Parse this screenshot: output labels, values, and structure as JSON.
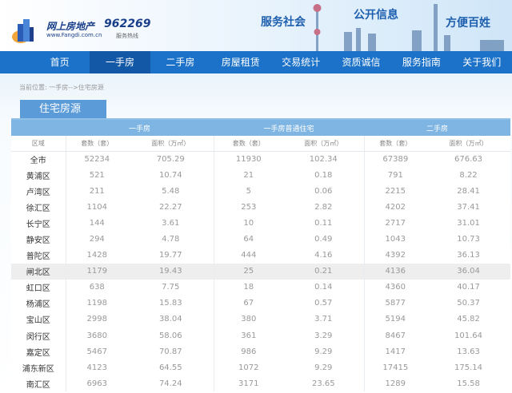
{
  "header": {
    "logo_text": "网上房地产",
    "logo_url": "www.Fangdi.com.cn",
    "phone": "962269",
    "phone_sub": "服务热线",
    "slogans": [
      "服务社会",
      "公开信息",
      "方便百姓"
    ]
  },
  "nav": [
    "首页",
    "一手房",
    "二手房",
    "房屋租赁",
    "交易统计",
    "资质诚信",
    "服务指南",
    "关于我们"
  ],
  "breadcrumb": "当前位置: 一手房-->住宅房源",
  "tab": "住宅房源",
  "table": {
    "groups": [
      "一手房",
      "一手房普通住宅",
      "二手房"
    ],
    "subheaders": [
      "区域",
      "套数（套）",
      "面积（万㎡）",
      "套数（套）",
      "面积（万㎡）",
      "套数（套）",
      "面积（万㎡）"
    ],
    "rows": [
      [
        "全市",
        "52234",
        "705.29",
        "11930",
        "102.34",
        "67389",
        "676.63"
      ],
      [
        "黄浦区",
        "521",
        "10.74",
        "21",
        "0.18",
        "791",
        "8.22"
      ],
      [
        "卢湾区",
        "211",
        "5.48",
        "5",
        "0.06",
        "2215",
        "28.41"
      ],
      [
        "徐汇区",
        "1104",
        "22.27",
        "253",
        "2.82",
        "4202",
        "37.41"
      ],
      [
        "长宁区",
        "144",
        "3.61",
        "10",
        "0.11",
        "2717",
        "31.01"
      ],
      [
        "静安区",
        "294",
        "4.78",
        "64",
        "0.49",
        "1043",
        "10.73"
      ],
      [
        "普陀区",
        "1428",
        "19.77",
        "444",
        "4.16",
        "4392",
        "36.13"
      ],
      [
        "闸北区",
        "1179",
        "19.43",
        "25",
        "0.21",
        "4136",
        "36.04"
      ],
      [
        "虹口区",
        "638",
        "7.75",
        "18",
        "0.14",
        "4360",
        "40.17"
      ],
      [
        "杨浦区",
        "1198",
        "15.83",
        "67",
        "0.57",
        "5877",
        "50.37"
      ],
      [
        "宝山区",
        "2998",
        "38.04",
        "380",
        "3.71",
        "5194",
        "45.82"
      ],
      [
        "闵行区",
        "3680",
        "58.06",
        "361",
        "3.29",
        "8467",
        "101.64"
      ],
      [
        "嘉定区",
        "5467",
        "70.87",
        "986",
        "9.29",
        "1417",
        "13.63"
      ],
      [
        "浦东新区",
        "4123",
        "64.55",
        "1072",
        "9.29",
        "17415",
        "175.14"
      ],
      [
        "南汇区",
        "6963",
        "74.24",
        "3171",
        "23.65",
        "1289",
        "15.58"
      ]
    ]
  }
}
